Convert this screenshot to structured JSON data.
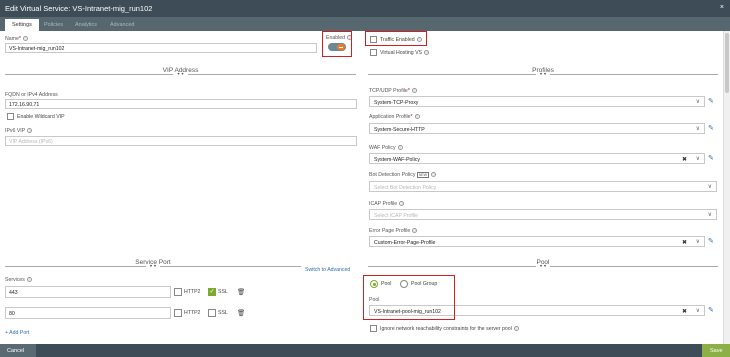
{
  "window": {
    "title": "Edit Virtual Service: VS-Intranet-mig_run102",
    "close": "×"
  },
  "tabs": [
    {
      "label": "Settings",
      "active": true
    },
    {
      "label": "Policies"
    },
    {
      "label": "Analytics"
    },
    {
      "label": "Advanced"
    }
  ],
  "name": {
    "label": "Name",
    "value": "VS-Intranet-mig_run102"
  },
  "enabled": {
    "label": "Enabled",
    "state": true
  },
  "traffic_enabled": {
    "label": "Traffic Enabled",
    "checked": false
  },
  "virtual_hosting": {
    "label": "Virtual Hosting VS",
    "checked": false
  },
  "vip": {
    "section_title": "VIP Address",
    "fqdn_label": "FQDN or IPv4 Address",
    "fqdn_value": "172.16.90.71",
    "wildcard_label": "Enable Wildcard VIP",
    "ipv6_label": "IPv6 VIP",
    "ipv6_placeholder": "VIP Address (IPv6)"
  },
  "profiles": {
    "section_title": "Profiles",
    "tcp_label": "TCP/UDP Profile",
    "tcp_value": "System-TCP-Proxy",
    "app_label": "Application Profile",
    "app_value": "System-Secure-HTTP",
    "waf_label": "WAF Policy",
    "waf_value": "System-WAF-Policy",
    "bot_label": "Bot Detection Policy",
    "bot_badge": "NEW",
    "bot_placeholder": "Select Bot Detection Policy",
    "icap_label": "ICAP Profile",
    "icap_placeholder": "Select ICAP Profile",
    "error_label": "Error Page Profile",
    "error_value": "Custom-Error-Page-Profile"
  },
  "service_port": {
    "section_title": "Service Port",
    "switch_link": "Switch to Advanced",
    "services_label": "Services",
    "rows": [
      {
        "port": "443",
        "http2": "HTTP2",
        "ssl": "SSL",
        "ssl_checked": true
      },
      {
        "port": "80",
        "http2": "HTTP2",
        "ssl": "SSL",
        "ssl_checked": false
      }
    ],
    "add_port": "+ Add Port"
  },
  "pool": {
    "section_title": "Pool",
    "radio_pool": "Pool",
    "radio_pool_group": "Pool Group",
    "pool_label": "Pool",
    "pool_value": "VS-Intranet-pool-mig_run102",
    "ignore_label": "Ignore network reachability constraints for the server pool"
  },
  "footer": {
    "cancel": "Cancel",
    "save": "Save"
  },
  "colors": {
    "header": "#3d4c57",
    "tabbar": "#56676f",
    "accent_green": "#8cb046",
    "highlight_red": "#d02020",
    "link_blue": "#2d6fb3"
  }
}
